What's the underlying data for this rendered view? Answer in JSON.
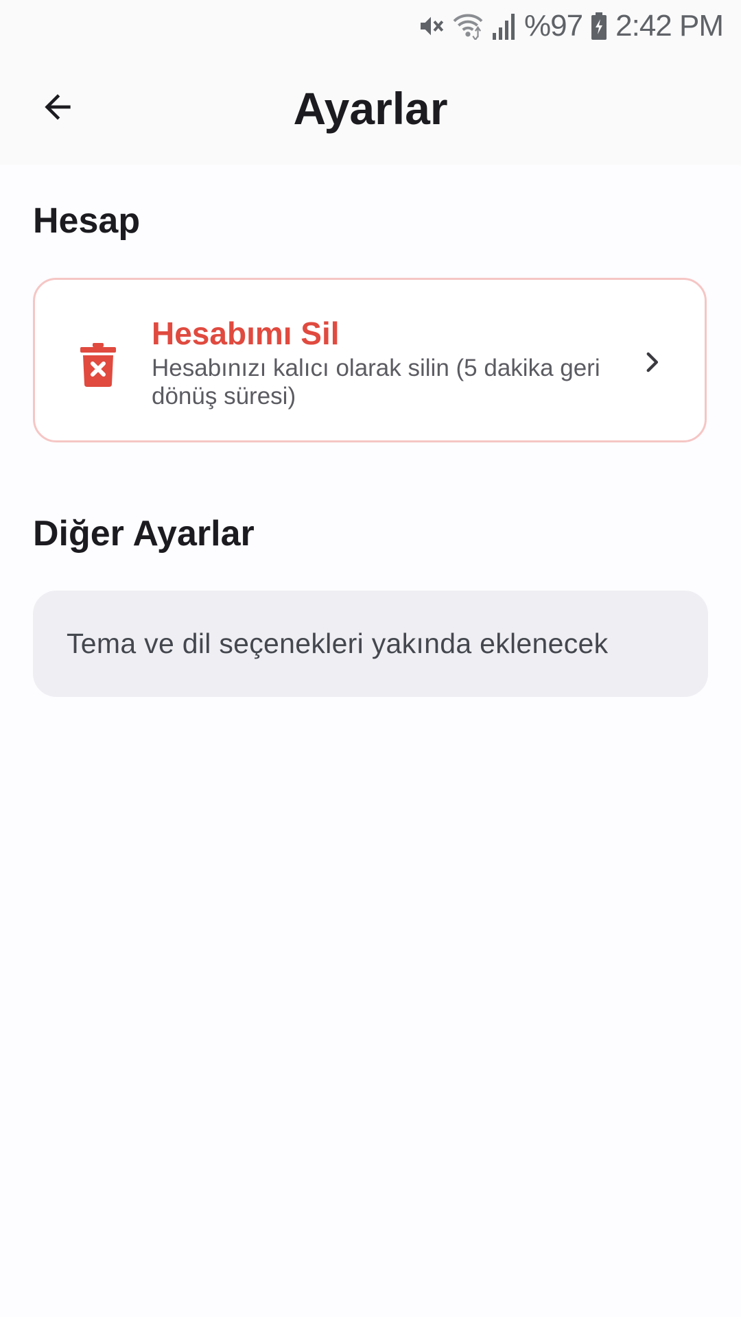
{
  "status_bar": {
    "battery": "%97",
    "time": "2:42 PM",
    "icons": [
      "mute-icon",
      "wifi-icon",
      "signal-icon",
      "battery-charging-icon"
    ]
  },
  "app_bar": {
    "title": "Ayarlar",
    "back_icon": "arrow-back-icon"
  },
  "sections": {
    "account": {
      "title": "Hesap",
      "delete_account": {
        "title": "Hesabımı Sil",
        "subtitle": "Hesabınızı kalıcı olarak silin (5 dakika geri dönüş süresi)",
        "icon": "trash-icon",
        "trailing_icon": "chevron-right-icon"
      }
    },
    "other": {
      "title": "Diğer Ayarlar",
      "info": "Tema ve dil seçenekleri yakında eklenecek"
    }
  },
  "colors": {
    "danger": "#E04A3F",
    "danger_border": "#F5C6C4",
    "background": "#FDFCFF",
    "topbar": "#FAFAFA",
    "info_card": "#EFEFF3"
  }
}
